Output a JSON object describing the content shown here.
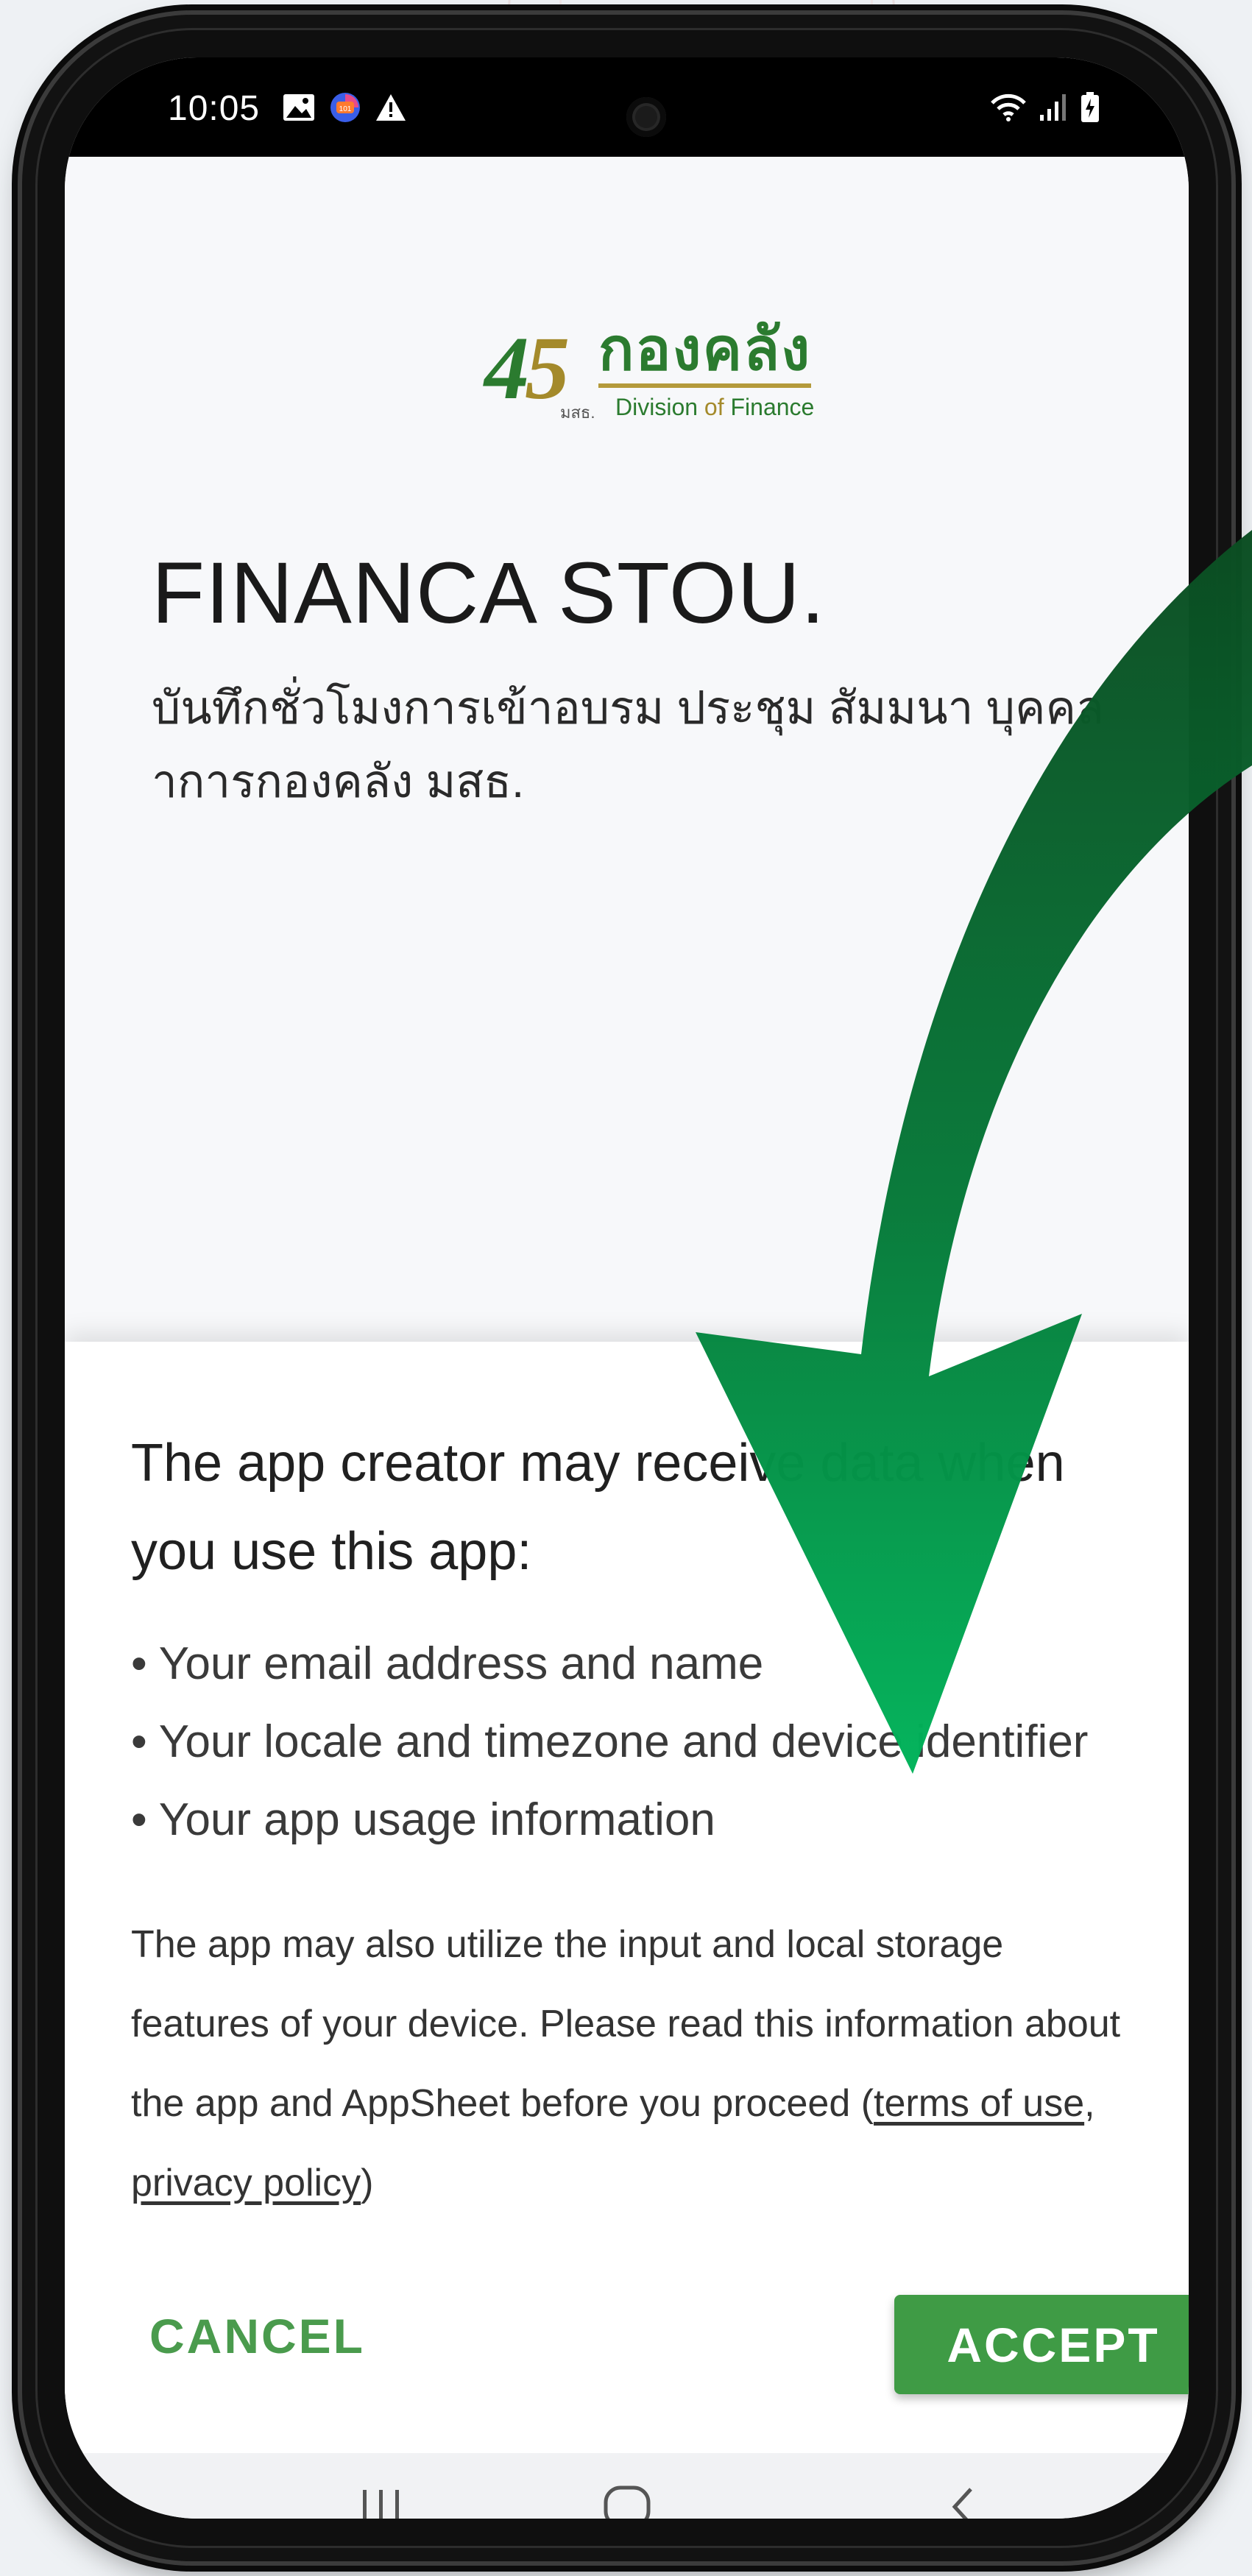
{
  "status_bar": {
    "time": "10:05"
  },
  "logo": {
    "number_4": "4",
    "number_5": "5",
    "thai": "กองคลัง",
    "small": "มสธ.",
    "eng_division": "Division",
    "eng_of": "of",
    "eng_finance": "Finance"
  },
  "app": {
    "title": "FINANCA STOU.",
    "subtitle": "บันทึกชั่วโมงการเข้าอบรม ประชุม สัมมนา บุคคลาการกองคลัง มสธ."
  },
  "consent": {
    "heading": "The app creator may receive data when you use this app:",
    "permissions": [
      "• Your email address and name",
      "• Your locale and timezone and device identifier",
      "• Your app usage information"
    ],
    "disclaimer_text": "The app may also utilize the input and local storage features of your device. Please read this information about the app and AppSheet before you proceed",
    "open_paren": "(",
    "terms_link": "terms of use",
    "comma": ", ",
    "privacy_link": "privacy policy",
    "close_paren": ")",
    "cancel_label": "CANCEL",
    "accept_label": "ACCEPT"
  },
  "colors": {
    "accent_green": "#3f9b45",
    "arrow_dark": "#0b4d22",
    "arrow_light": "#00b35a"
  },
  "icons": {
    "status_left": [
      "gallery-icon",
      "app-notification-icon",
      "warning-icon"
    ],
    "status_right": [
      "wifi-icon",
      "signal-icon",
      "battery-icon"
    ],
    "nav": [
      "recent-apps-icon",
      "home-icon",
      "back-icon"
    ]
  }
}
